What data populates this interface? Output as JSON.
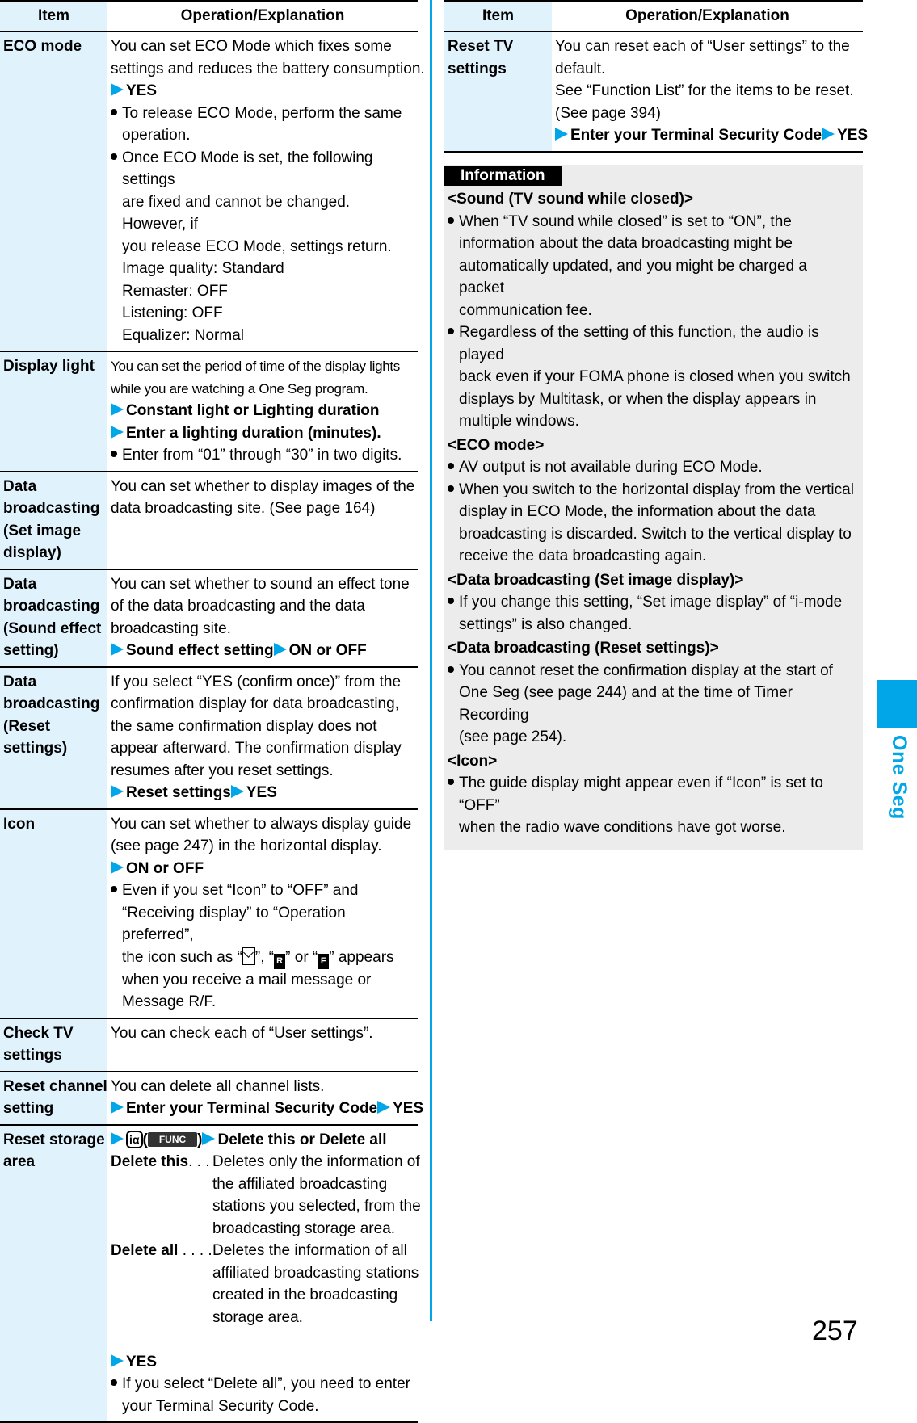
{
  "table_header": {
    "item": "Item",
    "operation": "Operation/Explanation"
  },
  "rows": [
    {
      "item": [
        "ECO mode"
      ],
      "text": [
        "You can set ECO Mode which fixes some",
        "settings and reduces the battery consumption."
      ],
      "steps": [
        [
          "YES"
        ]
      ],
      "bullets": [
        [
          "To release ECO Mode, perform the same",
          "operation."
        ],
        [
          "Once ECO Mode is set, the following settings",
          "are fixed and cannot be changed. However, if",
          "you release ECO Mode, settings return."
        ]
      ],
      "list": [
        "Image quality: Standard",
        "Remaster: OFF",
        "Listening: OFF",
        "Equalizer: Normal"
      ]
    },
    {
      "item": [
        "Display light"
      ],
      "text": [
        "You can set the period of time of the display lights",
        "while you are watching a One Seg program."
      ],
      "steps": [
        [
          "Constant light or Lighting duration"
        ],
        [
          "Enter a lighting duration (minutes)."
        ]
      ],
      "bullets": [
        [
          "Enter from “01” through “30” in two digits."
        ]
      ]
    },
    {
      "item": [
        "Data",
        "broadcasting",
        "(Set image",
        "display)"
      ],
      "text": [
        "You can set whether to display images of the",
        "data broadcasting site. (See page 164)"
      ]
    },
    {
      "item": [
        "Data",
        "broadcasting",
        "(Sound effect",
        "setting)"
      ],
      "text": [
        "You can set whether to sound an effect tone",
        "of the data broadcasting and the data",
        "broadcasting site."
      ],
      "steps": [
        [
          "Sound effect setting",
          "ON or OFF"
        ]
      ]
    },
    {
      "item": [
        "Data",
        "broadcasting",
        "(Reset",
        "settings)"
      ],
      "text": [
        "If you select “YES (confirm once)” from the",
        "confirmation display for data broadcasting,",
        "the same confirmation display does not",
        "appear afterward. The confirmation display",
        "resumes after you reset settings."
      ],
      "steps": [
        [
          "Reset settings",
          "YES"
        ]
      ]
    },
    {
      "item": [
        "Icon"
      ],
      "text": [
        "You can set whether to always display guide",
        "(see page 247) in the horizontal display."
      ],
      "steps": [
        [
          "ON or OFF"
        ]
      ],
      "bullets": [
        [
          "Even if you set “Icon” to “OFF” and",
          "“Receiving display” to “Operation preferred”,"
        ]
      ],
      "icon_line": {
        "prefix": "the icon such as “",
        "sep1": "”, “",
        "r": "R",
        "sep2": "” or “",
        "f": "F",
        "suffix": "” appears"
      },
      "after_icon": [
        "when you receive a mail message or",
        "Message R/F."
      ]
    },
    {
      "item": [
        "Check TV",
        "settings"
      ],
      "text": [
        "You can check each of “User settings”."
      ]
    },
    {
      "item": [
        "Reset channel",
        "setting"
      ],
      "text": [
        "You can delete all channel lists."
      ],
      "steps": [
        [
          "Enter your Terminal Security Code",
          "YES"
        ]
      ]
    },
    {
      "item": [
        "Reset storage",
        "area"
      ],
      "key_step": {
        "key_ia": "iα",
        "key_func": "FUNC",
        "action": "Delete this or Delete all"
      },
      "defs": [
        {
          "term": "Delete this",
          "dots": ". . .",
          "desc": [
            "Deletes only the information of",
            "the affiliated broadcasting",
            "stations you selected, from the",
            "broadcasting storage area."
          ]
        },
        {
          "term": "Delete all",
          "dots": " . . . .",
          "desc": [
            "Deletes the information of all",
            "affiliated broadcasting stations",
            "created in the broadcasting",
            "storage area."
          ]
        }
      ],
      "steps": [
        [
          "YES"
        ]
      ],
      "bullets": [
        [
          "If you select “Delete all”, you need to enter",
          "your Terminal Security Code."
        ]
      ]
    }
  ],
  "right_row": {
    "item": [
      "Reset TV",
      "settings"
    ],
    "text": [
      "You can reset each of “User settings” to the",
      "default.",
      "See “Function List” for the items to be reset.",
      "(See page 394)"
    ],
    "steps": [
      [
        "Enter your Terminal Security Code",
        "YES"
      ]
    ]
  },
  "information": {
    "label": "Information",
    "sections": [
      {
        "heading": "<Sound (TV sound while closed)>",
        "bullets": [
          [
            "When “TV sound while closed” is set to “ON”, the",
            "information about the data broadcasting might be",
            "automatically updated, and you might be charged a packet",
            "communication fee."
          ],
          [
            "Regardless of the setting of this function, the audio is played",
            "back even if your FOMA phone is closed when you switch",
            "displays by Multitask, or when the display appears in",
            "multiple windows."
          ]
        ]
      },
      {
        "heading": "<ECO mode>",
        "bullets": [
          [
            "AV output is not available during ECO Mode."
          ],
          [
            "When you switch to the horizontal display from the vertical",
            "display in ECO Mode, the information about the data",
            "broadcasting is discarded. Switch to the vertical display to",
            "receive the data broadcasting again."
          ]
        ]
      },
      {
        "heading": "<Data broadcasting (Set image display)>",
        "bullets": [
          [
            "If you change this setting, “Set image display” of “i-mode",
            "settings” is also changed."
          ]
        ]
      },
      {
        "heading": "<Data broadcasting (Reset settings)>",
        "bullets": [
          [
            "You cannot reset the confirmation display at the start of",
            "One Seg (see page 244) and at the time of Timer Recording",
            "(see page 254)."
          ]
        ]
      },
      {
        "heading": "<Icon>",
        "bullets": [
          [
            "The guide display might appear even if “Icon” is set to “OFF”",
            "when the radio wave conditions have got worse."
          ]
        ]
      }
    ]
  },
  "side_tab": {
    "label": "One Seg",
    "color": "#00a6e8"
  },
  "accent_color": "#00a6e8",
  "page_number": "257"
}
